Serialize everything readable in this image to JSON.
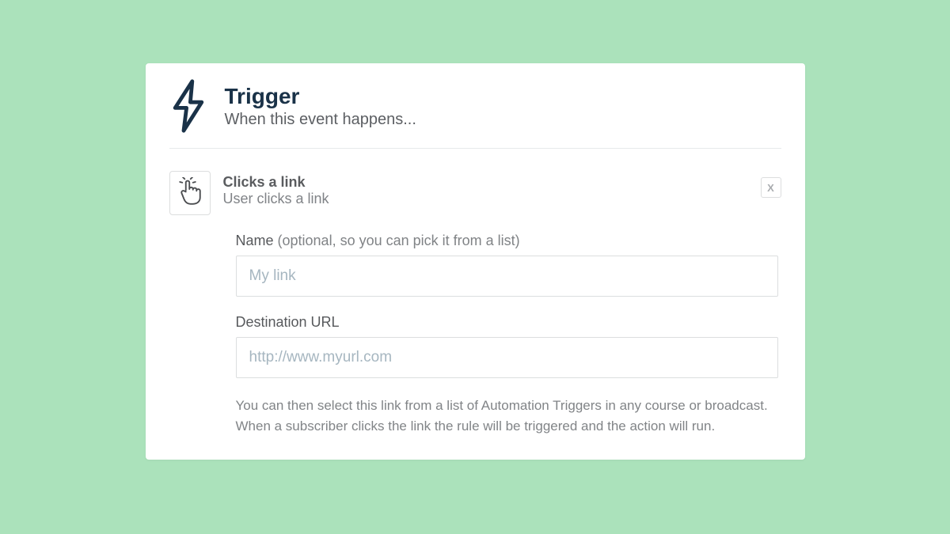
{
  "header": {
    "title": "Trigger",
    "subtitle": "When this event happens..."
  },
  "trigger": {
    "title": "Clicks a link",
    "subtitle": "User clicks a link",
    "close_label": "X"
  },
  "form": {
    "name": {
      "label": "Name ",
      "optional_text": "(optional, so you can pick it from a list)",
      "placeholder": "My link",
      "value": ""
    },
    "url": {
      "label": "Destination URL",
      "placeholder": "http://www.myurl.com",
      "value": ""
    },
    "help_text": "You can then select this link from a list of Automation Triggers in any course or broadcast. When a subscriber clicks the link the rule will be triggered and the action will run."
  }
}
